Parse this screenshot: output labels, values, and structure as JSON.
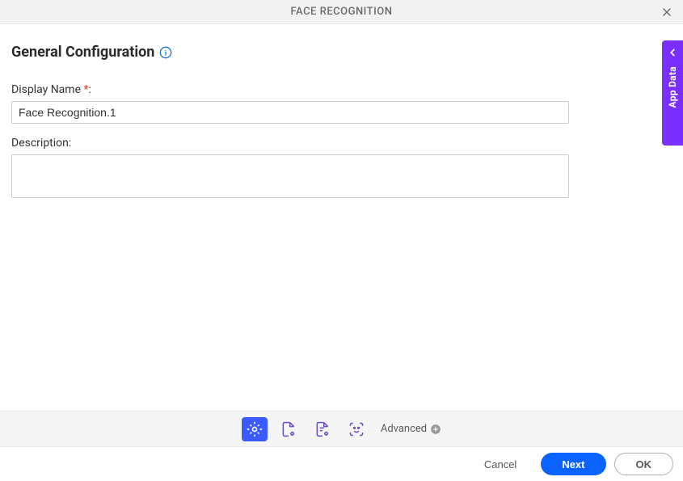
{
  "header": {
    "title": "FACE RECOGNITION"
  },
  "section": {
    "title": "General Configuration"
  },
  "form": {
    "display_name_label": "Display Name ",
    "display_name_required": "*",
    "display_name_colon": ":",
    "display_name_value": "Face Recognition.1",
    "description_label": "Description:",
    "description_value": ""
  },
  "icon_strip": {
    "advanced_label": "Advanced"
  },
  "footer": {
    "cancel": "Cancel",
    "next": "Next",
    "ok": "OK"
  },
  "side_tab": {
    "label": "App Data"
  },
  "colors": {
    "accent": "#3b5bff",
    "purple": "#7b2fff",
    "info": "#1976d2"
  }
}
